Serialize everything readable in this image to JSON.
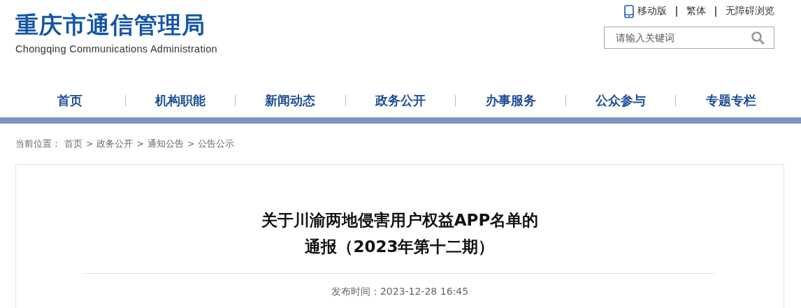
{
  "site": {
    "name": "重庆市通信管理局",
    "name_en": "Chongqing Communications Administration"
  },
  "top_links": [
    "移动版",
    "繁体",
    "无障碍浏览"
  ],
  "search": {
    "placeholder": "请输入关键词"
  },
  "nav": [
    "首页",
    "机构职能",
    "新闻动态",
    "政务公开",
    "办事服务",
    "公众参与",
    "专题专栏"
  ],
  "breadcrumb": {
    "label": "当前位置：",
    "separator": ">",
    "items": [
      "首页",
      "政务公开",
      "通知公告",
      "公告公示"
    ]
  },
  "article": {
    "title": "关于川渝两地侵害用户权益APP名单的通报（2023年第十二期）",
    "published": "发布时间：2023-12-28 16:45"
  }
}
